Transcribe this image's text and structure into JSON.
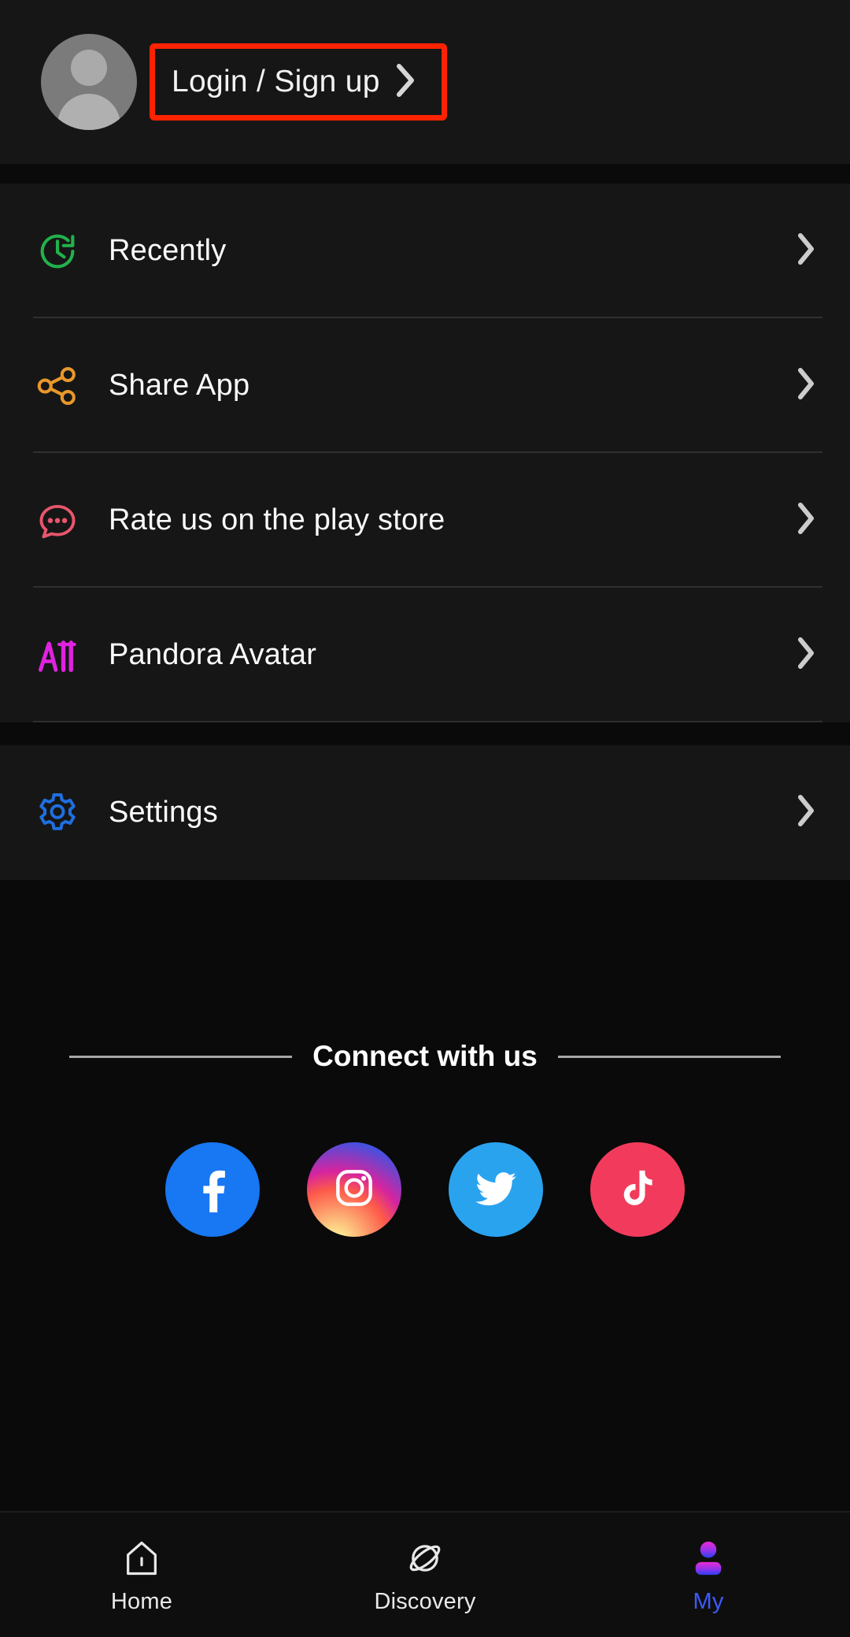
{
  "header": {
    "avatar_alt": "default user avatar",
    "login_label": "Login / Sign up",
    "chevron": "›",
    "highlight_color": "#fd2200"
  },
  "menu_groups": [
    {
      "items": [
        {
          "label": "Recently",
          "icon": "history-clock-icon",
          "icon_color": "#22b14c",
          "chevron": "›"
        },
        {
          "label": "Share App",
          "icon": "share-nodes-icon",
          "icon_color": "#e8982b",
          "chevron": "›"
        },
        {
          "label": "Rate us on the play store",
          "icon": "chat-bubble-dots-icon",
          "icon_color": "#e8566d",
          "chevron": "›"
        },
        {
          "label": "Pandora Avatar",
          "icon": "ai-avatar-icon",
          "icon_color": "#e022e0",
          "chevron": "›"
        }
      ]
    },
    {
      "items": [
        {
          "label": "Settings",
          "icon": "gear-icon",
          "icon_color": "#1f6fe0",
          "chevron": "›"
        }
      ]
    }
  ],
  "connect": {
    "title": "Connect with us",
    "socials": [
      {
        "name": "Facebook",
        "icon": "facebook-icon",
        "color": "#1877f2"
      },
      {
        "name": "Instagram",
        "icon": "instagram-icon",
        "color": "#d6249f"
      },
      {
        "name": "Twitter",
        "icon": "twitter-icon",
        "color": "#2aa3ef"
      },
      {
        "name": "TikTok",
        "icon": "tiktok-icon",
        "color": "#f23b5c"
      }
    ]
  },
  "bottom_nav": {
    "active": "My",
    "active_color": "#3d5afe",
    "items": [
      {
        "label": "Home",
        "icon": "home-icon"
      },
      {
        "label": "Discovery",
        "icon": "planet-icon"
      },
      {
        "label": "My",
        "icon": "person-icon"
      }
    ]
  }
}
